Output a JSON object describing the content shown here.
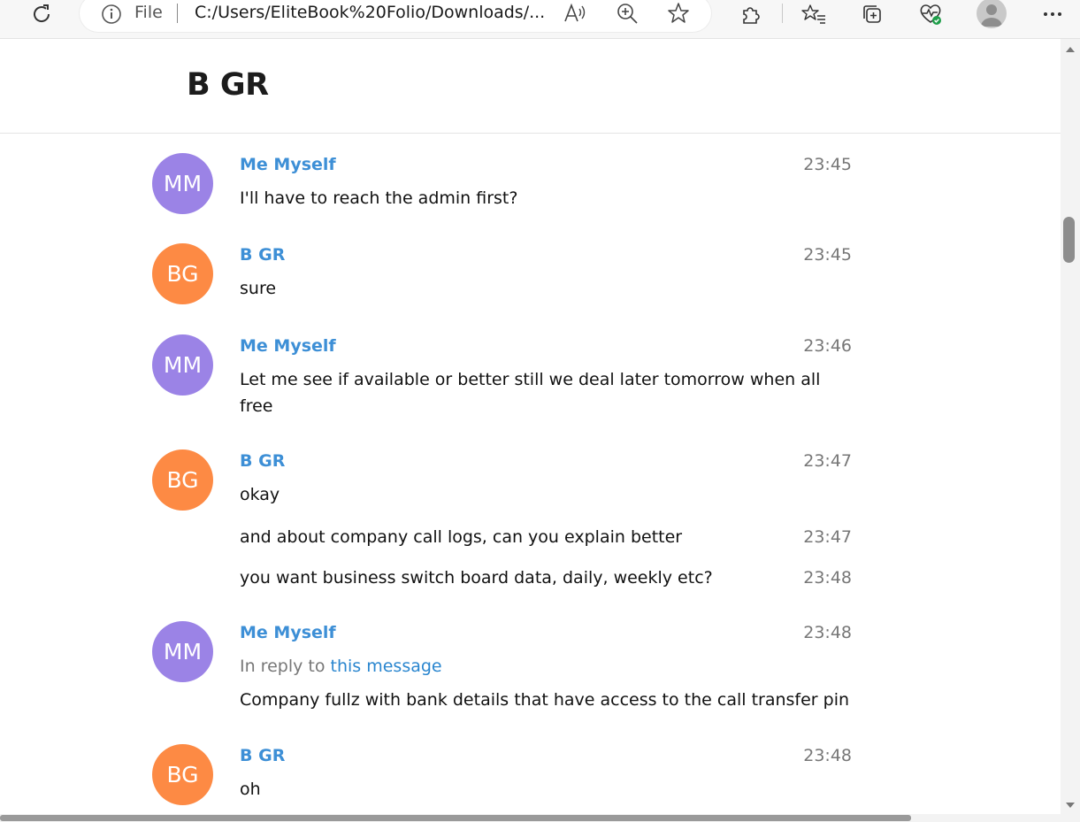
{
  "browser": {
    "address_scheme": "File",
    "address_url": "C:/Users/EliteBook%20Folio/Downloads/...",
    "icons": {
      "refresh": "refresh-icon",
      "info": "info-icon",
      "read_aloud": "read-aloud-icon",
      "zoom": "zoom-icon",
      "favorite": "star-icon",
      "extensions": "extensions-icon",
      "favorites": "favorites-icon",
      "collections": "collections-icon",
      "performance": "heartbeat-icon",
      "profile": "profile-icon",
      "more": "more-icon"
    }
  },
  "chat": {
    "title": "B GR",
    "messages": [
      {
        "initials": "MM",
        "from": "Me Myself",
        "time": "23:45",
        "text": "I'll have to reach the admin first?"
      },
      {
        "initials": "BG",
        "from": "B GR",
        "time": "23:45",
        "text": "sure"
      },
      {
        "initials": "MM",
        "from": "Me Myself",
        "time": "23:46",
        "text": "Let me see if available or better still we deal later tomorrow when all free"
      },
      {
        "initials": "BG",
        "from": "B GR",
        "time": "23:47",
        "text": "okay"
      },
      {
        "time": "23:47",
        "text": "and about company call logs, can you explain better"
      },
      {
        "time": "23:48",
        "text": "you want business switch board data, daily, weekly etc?"
      },
      {
        "initials": "MM",
        "from": "Me Myself",
        "time": "23:48",
        "reply_prefix": "In reply to",
        "reply_link": "this message",
        "text": "Company fullz with bank details that have access to the call transfer pin"
      },
      {
        "initials": "BG",
        "from": "B GR",
        "time": "23:48",
        "text": "oh"
      }
    ]
  },
  "colors": {
    "avatar_me": "#9b83e6",
    "avatar_bgr": "#fd8a44",
    "name_blue": "#3d8fd6",
    "link_blue": "#2a86cf"
  }
}
